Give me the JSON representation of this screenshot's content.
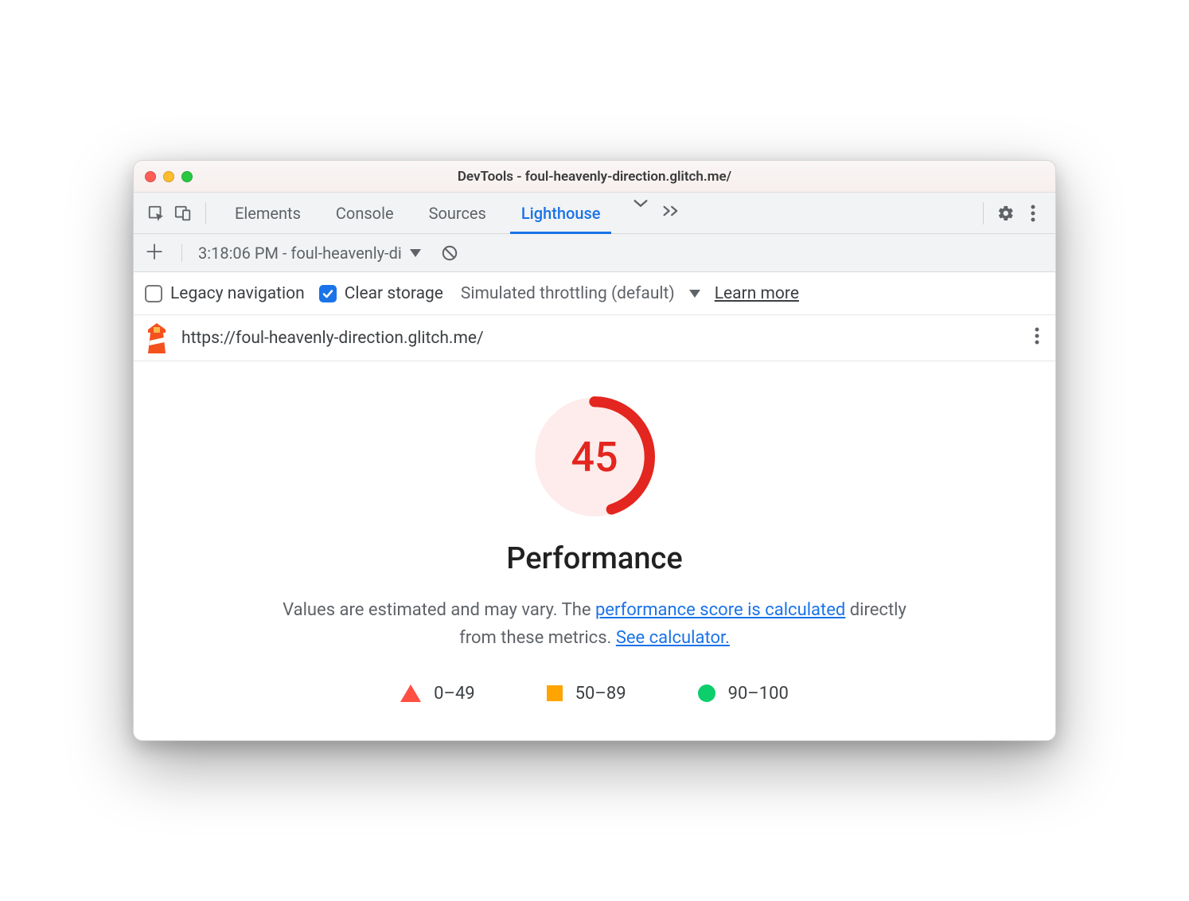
{
  "window": {
    "title": "DevTools - foul-heavenly-direction.glitch.me/"
  },
  "tabs": {
    "items": [
      "Elements",
      "Console",
      "Sources",
      "Lighthouse"
    ],
    "active_index": 3
  },
  "report_selector": {
    "label": "3:18:06 PM - foul-heavenly-di"
  },
  "options": {
    "legacy_navigation": {
      "label": "Legacy navigation",
      "checked": false
    },
    "clear_storage": {
      "label": "Clear storage",
      "checked": true
    },
    "throttling": {
      "label": "Simulated throttling (default)"
    },
    "learn_more": "Learn more"
  },
  "url_bar": {
    "url": "https://foul-heavenly-direction.glitch.me/"
  },
  "gauge": {
    "score": "45",
    "score_value": 45,
    "category": "Performance",
    "color": "#e3261f",
    "bg": "#fdeceb",
    "disclaimer_prefix": "Values are estimated and may vary. The ",
    "disclaimer_link1": "performance score is calculated",
    "disclaimer_mid": " directly from these metrics. ",
    "disclaimer_link2": "See calculator."
  },
  "legend": {
    "fail": "0–49",
    "avg": "50–89",
    "pass": "90–100"
  }
}
